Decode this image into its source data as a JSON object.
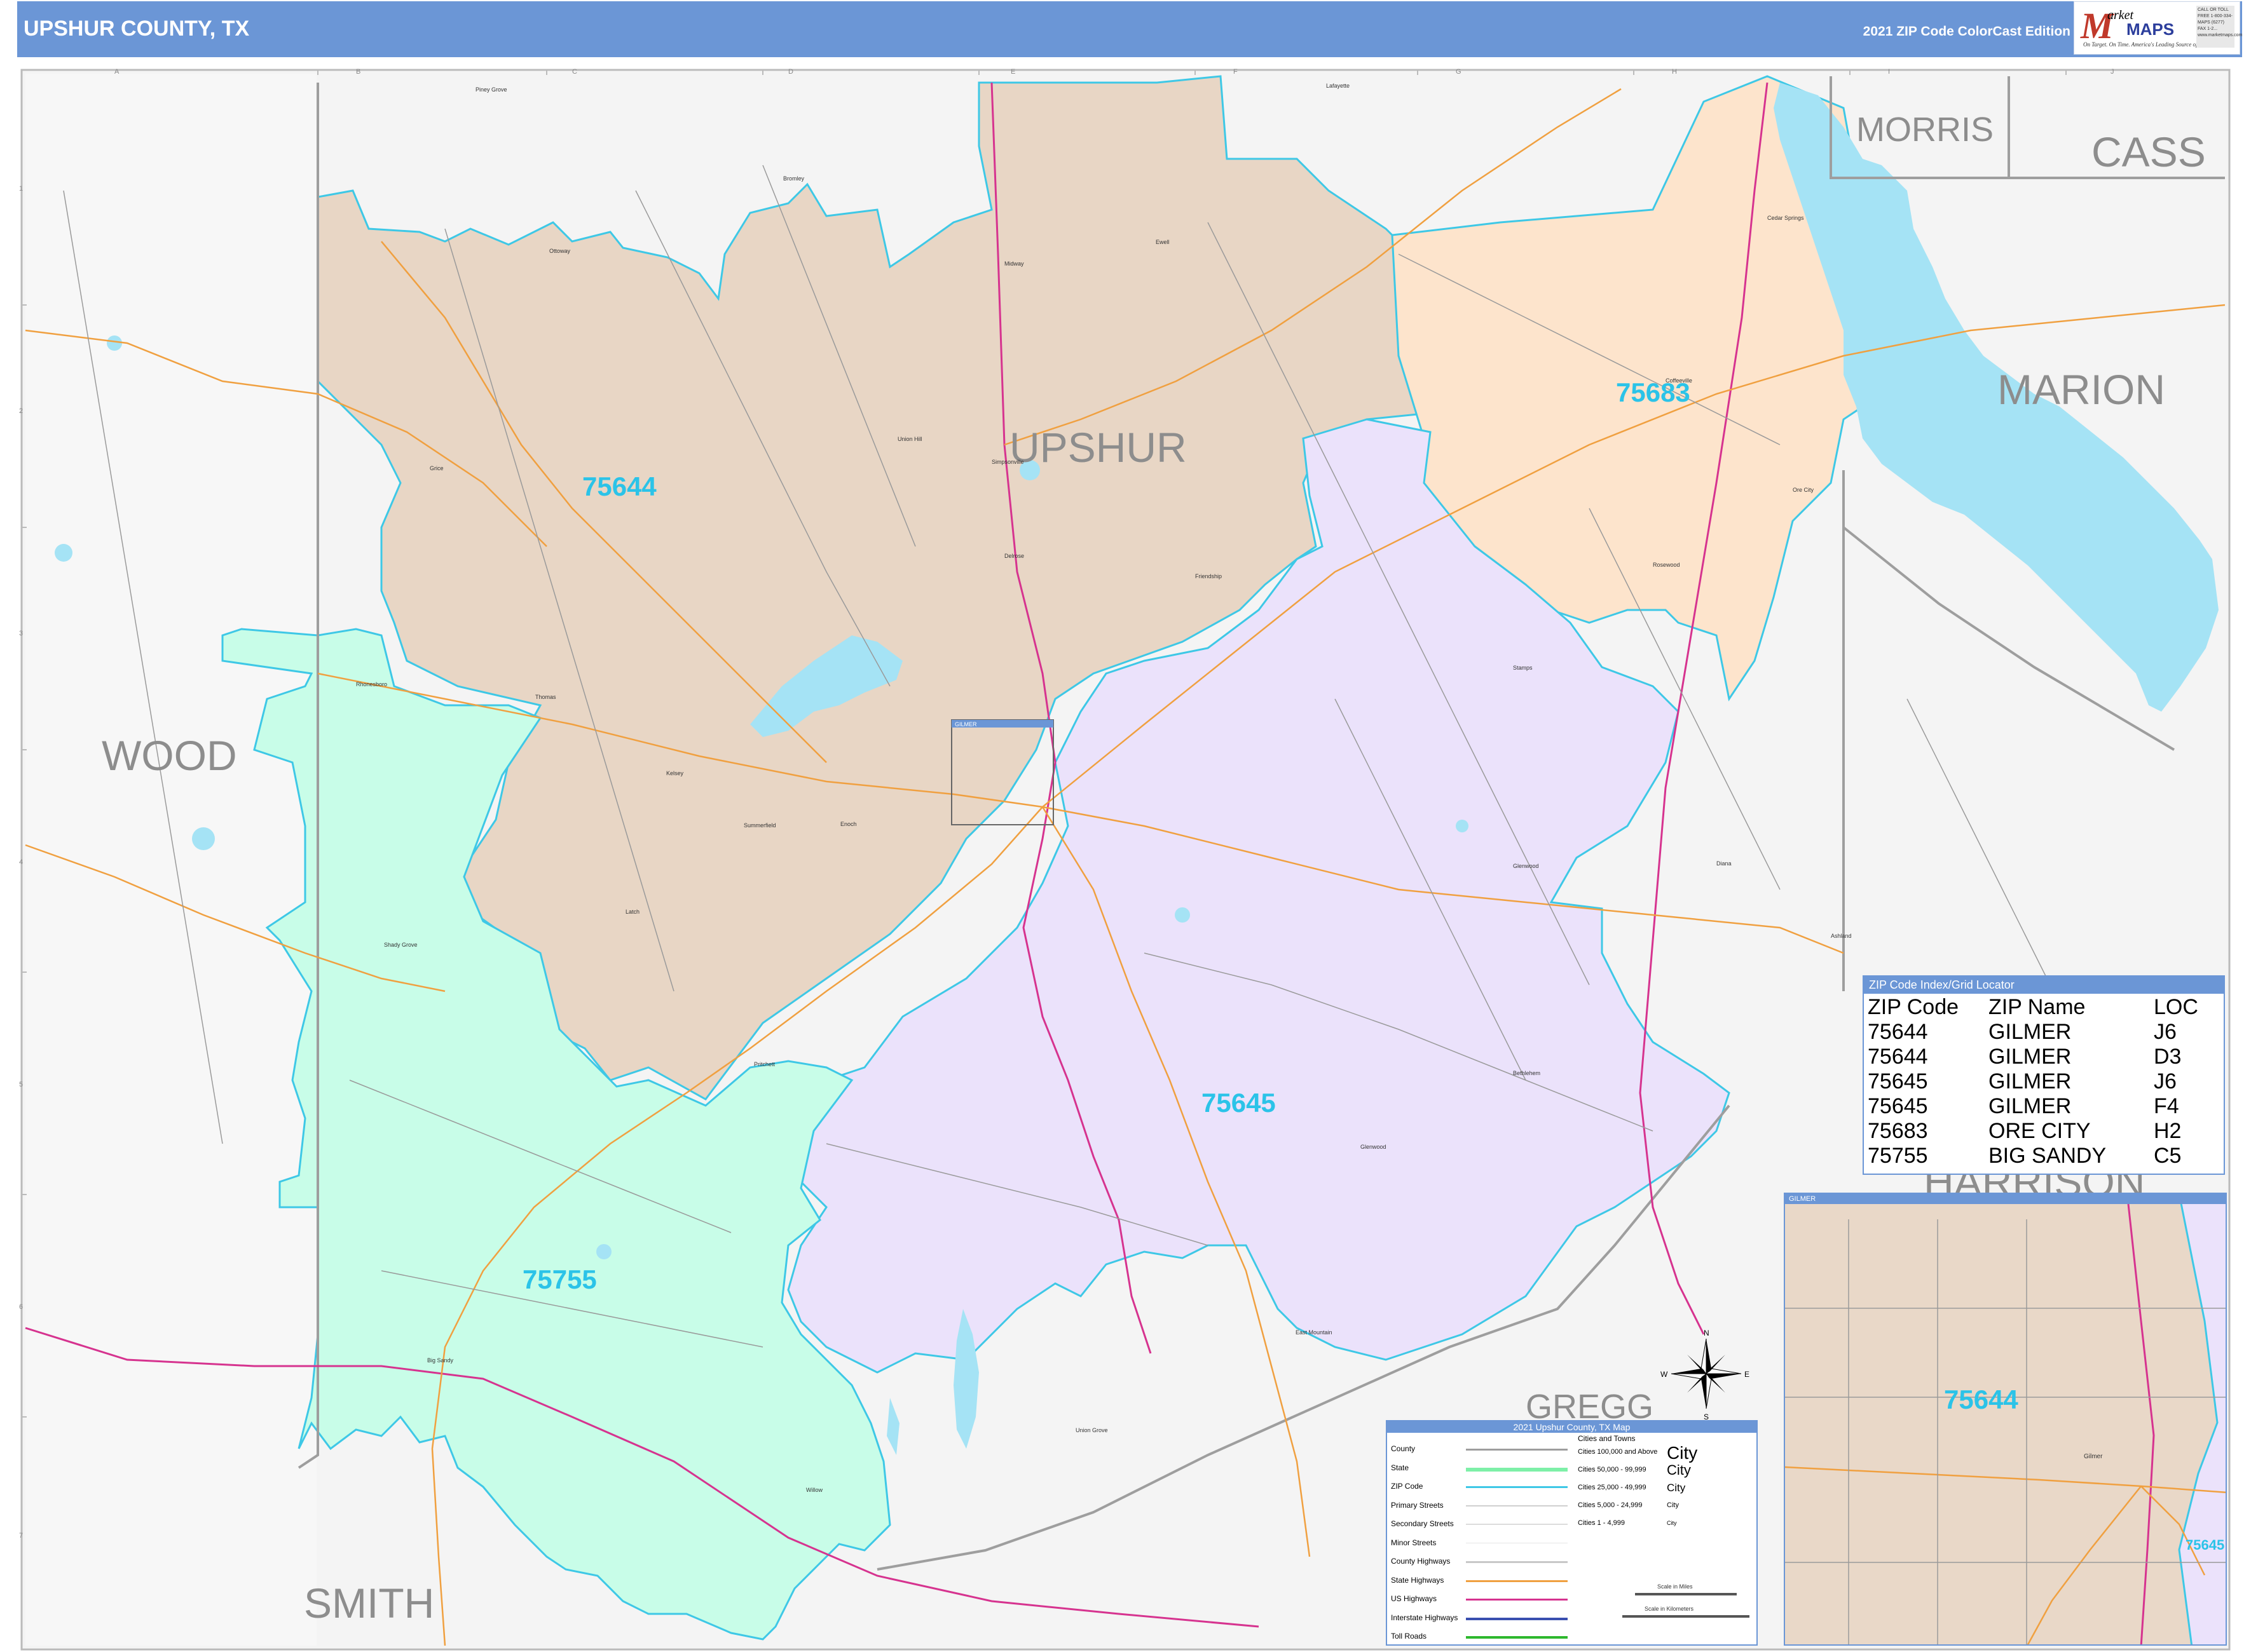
{
  "header": {
    "title": "UPSHUR COUNTY, TX",
    "edition": "2021 ZIP Code ColorCast Edition"
  },
  "logo": {
    "m_letter": "M",
    "arket": "arket",
    "maps": "MAPS",
    "tagline": "On Target. On Time. America's Leading Source of Business Maps",
    "contact": "CALL OR TOLL FREE 1-800-334-MAPS (6277) FAX 1-2... www.marketmaps.com"
  },
  "grid": {
    "columns": [
      "A",
      "B",
      "C",
      "D",
      "E",
      "F",
      "G",
      "H",
      "I",
      "J"
    ],
    "rows": [
      "1",
      "2",
      "3",
      "4",
      "5",
      "6",
      "7"
    ]
  },
  "counties": {
    "upshur": "UPSHUR",
    "morris": "MORRIS",
    "cass": "CASS",
    "marion": "MARION",
    "wood": "WOOD",
    "smith": "SMITH",
    "harrison": "HARRISON",
    "gregg": "GREGG"
  },
  "zip_labels": {
    "z75644": "75644",
    "z75683": "75683",
    "z75645": "75645",
    "z75755": "75755"
  },
  "towns": {
    "piney_grove": "Piney Grove",
    "lafayette": "Lafayette",
    "bromley": "Bromley",
    "shady_grove_n": "Ottoway",
    "midway": "Midway",
    "ewell": "Ewell",
    "cedar_springs": "Cedar Springs",
    "coffeeville": "Coffeeville",
    "grice": "Grice",
    "union_hill": "Union Hill",
    "simpsonville": "Simpsonville",
    "ore_city": "Ore City",
    "rosewood": "Rosewood",
    "delrose": "Delrose",
    "friendship": "Friendship",
    "rhonesboro": "Rhonesboro",
    "thomas": "Thomas",
    "stamps": "Stamps",
    "kelsey": "Kelsey",
    "summerfield": "Summerfield",
    "enoch": "Enoch",
    "glenwood_n": "Glenwood",
    "diana": "Diana",
    "ashland": "Ashland",
    "latch": "Latch",
    "shady_grove": "Shady Grove",
    "pritchett": "Pritchett",
    "bethlehem": "Bethlehem",
    "glenwood": "Glenwood",
    "big_sandy": "Big Sandy",
    "union_grove": "Union Grove",
    "east_mountain": "East Mountain",
    "willow": "Willow",
    "gilmer_inset": "Gilmer"
  },
  "inset_label_main": "GILMER",
  "zip_index": {
    "title": "ZIP Code Index/Grid Locator",
    "headers": [
      "ZIP Code",
      "ZIP Name",
      "LOC"
    ],
    "rows": [
      [
        "75644",
        "GILMER",
        "J6"
      ],
      [
        "75644",
        "GILMER",
        "D3"
      ],
      [
        "75645",
        "GILMER",
        "J6"
      ],
      [
        "75645",
        "GILMER",
        "F4"
      ],
      [
        "75683",
        "ORE CITY",
        "H2"
      ],
      [
        "75755",
        "BIG SANDY",
        "C5"
      ]
    ]
  },
  "legend": {
    "title": "2021 Upshur County, TX Map",
    "items": [
      "County",
      "State",
      "ZIP Code",
      "Primary Streets",
      "Secondary Streets",
      "Minor Streets",
      "County Highways",
      "State Highways",
      "US Highways",
      "Interstate Highways",
      "Toll Roads"
    ],
    "cities_title": "Cities and Towns",
    "city_rows": [
      {
        "label": "Cities 100,000 and Above",
        "example": "City"
      },
      {
        "label": "Cities 50,000 - 99,999",
        "example": "City"
      },
      {
        "label": "Cities 25,000 - 49,999",
        "example": "City"
      },
      {
        "label": "Cities 5,000 - 24,999",
        "example": "City"
      },
      {
        "label": "Cities 1 - 4,999",
        "example": "City"
      }
    ],
    "scale_miles": "Scale in Miles",
    "scale_km": "Scale in Kilometers"
  },
  "inset": {
    "title": "GILMER",
    "zip_main": "75644",
    "zip_edge": "75645"
  },
  "compass": {
    "n": "N",
    "s": "S",
    "e": "E",
    "w": "W"
  },
  "colors": {
    "header": "#6b96d6",
    "zip_75644": "#e8d6c5",
    "zip_75683": "#fde4cc",
    "zip_75645": "#ebe2fb",
    "zip_75755": "#c8fde8",
    "water": "#a5e3f5",
    "zip_label": "#2bc3e8",
    "outside": "#f3f3f3"
  }
}
